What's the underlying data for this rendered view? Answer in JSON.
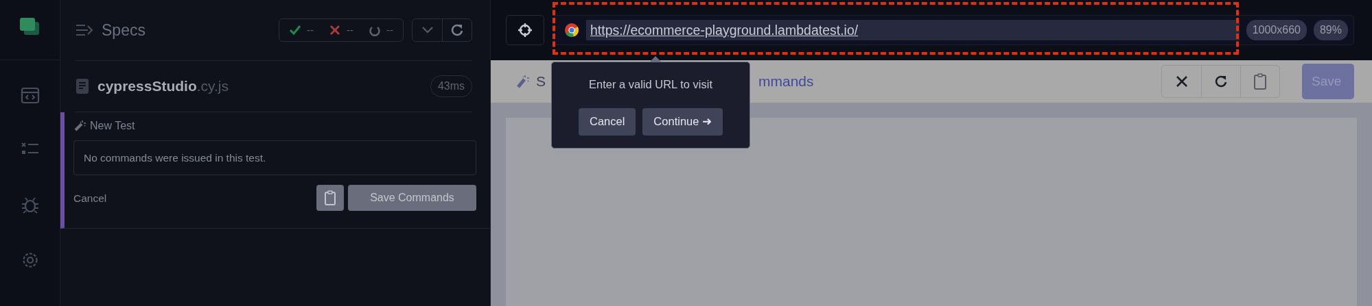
{
  "specs": {
    "title": "Specs",
    "stats": [
      {
        "kind": "passed",
        "text": "--"
      },
      {
        "kind": "failed",
        "text": "--"
      },
      {
        "kind": "pending",
        "text": "--"
      }
    ],
    "file": {
      "name": "cypressStudio",
      "ext": ".cy.js",
      "duration": "43ms"
    },
    "test": {
      "title": "New Test",
      "message": "No commands were issued in this test.",
      "cancel": "Cancel",
      "save": "Save Commands"
    }
  },
  "url_bar": {
    "url": "https://ecommerce-playground.lambdatest.io/",
    "viewport": "1000x660",
    "zoom": "89%"
  },
  "studio_bar": {
    "title_start": "S",
    "title_end": "mmands",
    "save": "Save"
  },
  "popup": {
    "message": "Enter a valid URL to visit",
    "cancel": "Cancel",
    "continue": "Continue ➜"
  }
}
